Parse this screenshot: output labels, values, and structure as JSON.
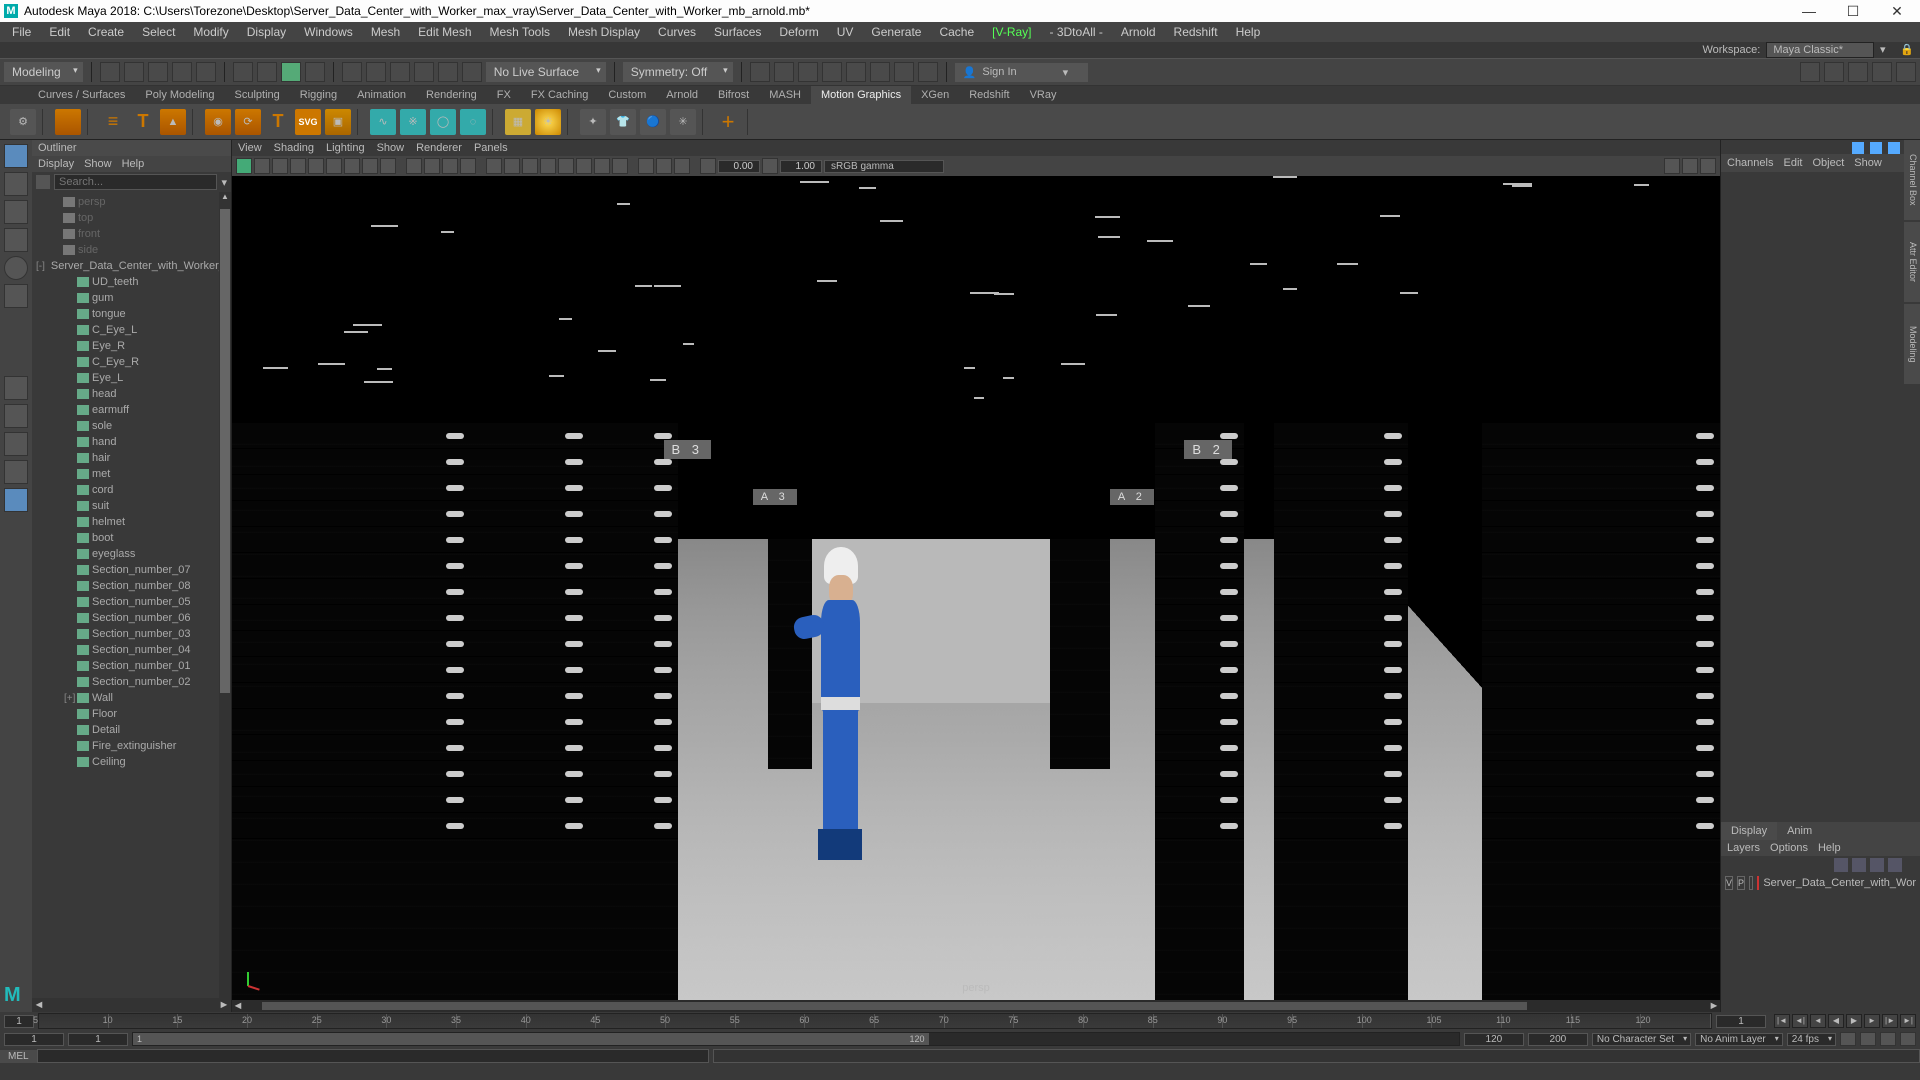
{
  "title": "Autodesk Maya 2018: C:\\Users\\Torezone\\Desktop\\Server_Data_Center_with_Worker_max_vray\\Server_Data_Center_with_Worker_mb_arnold.mb*",
  "menus": [
    "File",
    "Edit",
    "Create",
    "Select",
    "Modify",
    "Display",
    "Windows",
    "Mesh",
    "Edit Mesh",
    "Mesh Tools",
    "Mesh Display",
    "Curves",
    "Surfaces",
    "Deform",
    "UV",
    "Generate",
    "Cache",
    "[V-Ray]",
    "- 3DtoAll -",
    "Arnold",
    "Redshift",
    "Help"
  ],
  "workspace": {
    "label": "Workspace:",
    "value": "Maya Classic*"
  },
  "mode_dd": "Modeling",
  "live_surface": "No Live Surface",
  "symmetry": "Symmetry: Off",
  "signin": "Sign In",
  "shelf_tabs": [
    "Curves / Surfaces",
    "Poly Modeling",
    "Sculpting",
    "Rigging",
    "Animation",
    "Rendering",
    "FX",
    "FX Caching",
    "Custom",
    "Arnold",
    "Bifrost",
    "MASH",
    "Motion Graphics",
    "XGen",
    "Redshift",
    "VRay"
  ],
  "shelf_active": "Motion Graphics",
  "outliner": {
    "title": "Outliner",
    "menu": [
      "Display",
      "Show",
      "Help"
    ],
    "search_ph": "Search...",
    "items": [
      {
        "t": "persp",
        "dim": true,
        "kind": "cam",
        "ind": 1
      },
      {
        "t": "top",
        "dim": true,
        "kind": "cam",
        "ind": 1
      },
      {
        "t": "front",
        "dim": true,
        "kind": "cam",
        "ind": 1
      },
      {
        "t": "side",
        "dim": true,
        "kind": "cam",
        "ind": 1
      },
      {
        "t": "Server_Data_Center_with_Worker_ncl",
        "kind": "grp",
        "ind": 0,
        "exp": "-"
      },
      {
        "t": "UD_teeth",
        "kind": "mesh",
        "ind": 2
      },
      {
        "t": "gum",
        "kind": "mesh",
        "ind": 2
      },
      {
        "t": "tongue",
        "kind": "mesh",
        "ind": 2
      },
      {
        "t": "C_Eye_L",
        "kind": "mesh",
        "ind": 2
      },
      {
        "t": "Eye_R",
        "kind": "mesh",
        "ind": 2
      },
      {
        "t": "C_Eye_R",
        "kind": "mesh",
        "ind": 2
      },
      {
        "t": "Eye_L",
        "kind": "mesh",
        "ind": 2
      },
      {
        "t": "head",
        "kind": "mesh",
        "ind": 2
      },
      {
        "t": "earmuff",
        "kind": "mesh",
        "ind": 2
      },
      {
        "t": "sole",
        "kind": "mesh",
        "ind": 2
      },
      {
        "t": "hand",
        "kind": "mesh",
        "ind": 2
      },
      {
        "t": "hair",
        "kind": "mesh",
        "ind": 2
      },
      {
        "t": "met",
        "kind": "mesh",
        "ind": 2
      },
      {
        "t": "cord",
        "kind": "mesh",
        "ind": 2
      },
      {
        "t": "suit",
        "kind": "mesh",
        "ind": 2
      },
      {
        "t": "helmet",
        "kind": "mesh",
        "ind": 2
      },
      {
        "t": "boot",
        "kind": "mesh",
        "ind": 2
      },
      {
        "t": "eyeglass",
        "kind": "mesh",
        "ind": 2
      },
      {
        "t": "Section_number_07",
        "kind": "mesh",
        "ind": 2
      },
      {
        "t": "Section_number_08",
        "kind": "mesh",
        "ind": 2
      },
      {
        "t": "Section_number_05",
        "kind": "mesh",
        "ind": 2
      },
      {
        "t": "Section_number_06",
        "kind": "mesh",
        "ind": 2
      },
      {
        "t": "Section_number_03",
        "kind": "mesh",
        "ind": 2
      },
      {
        "t": "Section_number_04",
        "kind": "mesh",
        "ind": 2
      },
      {
        "t": "Section_number_01",
        "kind": "mesh",
        "ind": 2
      },
      {
        "t": "Section_number_02",
        "kind": "mesh",
        "ind": 2
      },
      {
        "t": "Wall",
        "kind": "mesh",
        "ind": 2,
        "exp": "+"
      },
      {
        "t": "Floor",
        "kind": "mesh",
        "ind": 2
      },
      {
        "t": "Detail",
        "kind": "mesh",
        "ind": 2
      },
      {
        "t": "Fire_extinguisher",
        "kind": "mesh",
        "ind": 2
      },
      {
        "t": "Ceiling",
        "kind": "mesh",
        "ind": 2
      }
    ]
  },
  "vp_menu": [
    "View",
    "Shading",
    "Lighting",
    "Show",
    "Renderer",
    "Panels"
  ],
  "vp_exposure": "0.00",
  "vp_gamma": "1.00",
  "vp_colormgmt": "sRGB gamma",
  "signs": {
    "b3": "B  3",
    "a3": "A  3",
    "a2": "A  2",
    "b2": "B  2"
  },
  "camera": "persp",
  "cb_menu": [
    "Channels",
    "Edit",
    "Object",
    "Show"
  ],
  "layers": {
    "tabs": [
      "Display",
      "Anim"
    ],
    "menu": [
      "Layers",
      "Options",
      "Help"
    ],
    "row": {
      "v": "V",
      "p": "P",
      "name": "Server_Data_Center_with_Wor"
    }
  },
  "time": {
    "cur": "1",
    "ticks": [
      "5",
      "10",
      "15",
      "20",
      "25",
      "30",
      "35",
      "40",
      "45",
      "50",
      "55",
      "60",
      "65",
      "70",
      "75",
      "80",
      "85",
      "90",
      "95",
      "100",
      "105",
      "110",
      "115",
      "120"
    ],
    "end": "1",
    "range_start": "1",
    "range_inner_start": "1",
    "range_inner_end": "120",
    "range_end_a": "120",
    "range_end_b": "200",
    "charset": "No Character Set",
    "animlayer": "No Anim Layer",
    "fps": "24 fps"
  },
  "cmd_label": "MEL",
  "logo": "M"
}
